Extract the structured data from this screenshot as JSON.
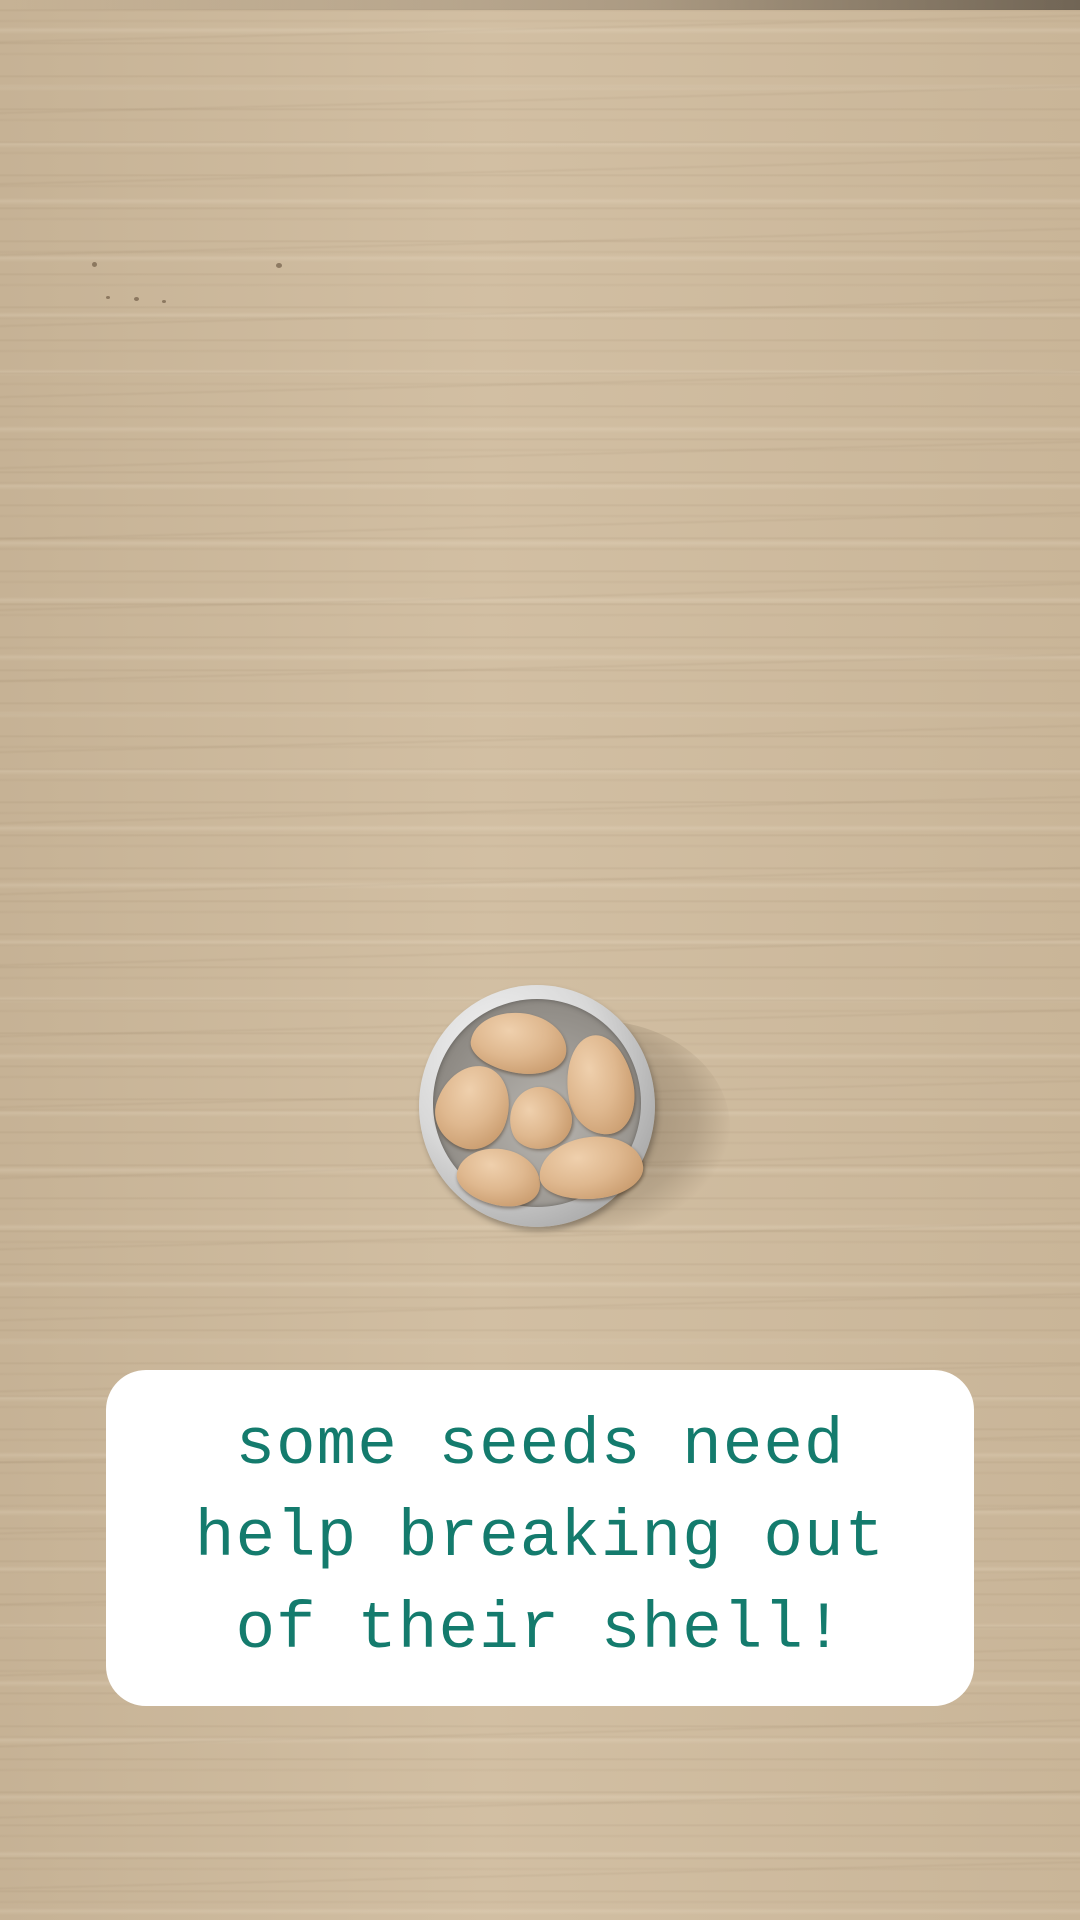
{
  "caption": {
    "lines": [
      "some seeds need",
      "help breaking out",
      "of their shell!"
    ],
    "text_color": "#147b6d",
    "background_color": "#ffffff"
  },
  "scene": {
    "surface_color": "#cbb79b",
    "container_color": "#d8d8d8",
    "seed_count": 6,
    "seed_color": "#dfb88f"
  }
}
